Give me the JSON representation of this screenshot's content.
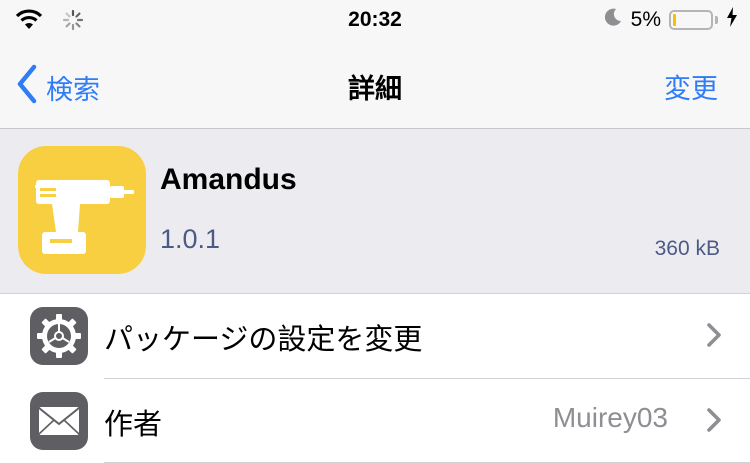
{
  "status_bar": {
    "time": "20:32",
    "battery_percent": "5%",
    "battery_level": 0.05,
    "battery_color": "#f5c200",
    "icons": [
      "wifi-icon",
      "activity-spinner-icon",
      "do-not-disturb-moon-icon",
      "battery-icon",
      "charging-bolt-icon"
    ]
  },
  "nav": {
    "back_label": "検索",
    "title": "詳細",
    "edit_label": "変更",
    "accent": "#2f7cf6"
  },
  "package": {
    "name": "Amandus",
    "version": "1.0.1",
    "size": "360 kB",
    "icon": "drill-icon",
    "icon_color": "#f8cf40"
  },
  "rows": [
    {
      "icon": "gear-icon",
      "label": "パッケージの設定を変更",
      "value": ""
    },
    {
      "icon": "envelope-icon",
      "label": "作者",
      "value": "Muirey03"
    }
  ]
}
